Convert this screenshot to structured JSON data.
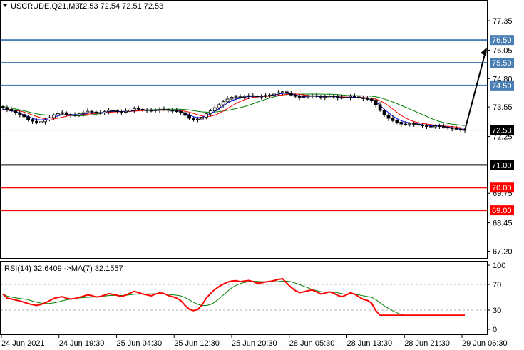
{
  "header": {
    "symbol": "USCRUDE.Q21,M30",
    "ohlc": "72.53 72.54 72.51 72.53"
  },
  "colors": {
    "blue_level": "#4a7fb5",
    "black_level": "#000000",
    "red_level": "#ff0000",
    "ma_fast": "#0000ff",
    "ma_mid": "#ff0000",
    "ma_slow": "#008000",
    "rsi_line": "#ff0000",
    "rsi_ma": "#008000",
    "candle": "#000000",
    "grid": "#c0c0c0",
    "current_price": "#c0c0c0"
  },
  "price_axis": {
    "labels": [
      "77.35",
      "76.05",
      "74.80",
      "73.55",
      "72.25",
      "69.75",
      "68.45",
      "67.20"
    ],
    "range": [
      66.9,
      78.2
    ]
  },
  "levels": [
    {
      "price": "76.50",
      "color": "blue"
    },
    {
      "price": "75.50",
      "color": "blue"
    },
    {
      "price": "74.50",
      "color": "blue"
    },
    {
      "price": "72.53",
      "color": "current"
    },
    {
      "price": "71.00",
      "color": "black"
    },
    {
      "price": "70.00",
      "color": "red"
    },
    {
      "price": "69.00",
      "color": "red"
    }
  ],
  "arrow": {
    "from_price": 72.53,
    "to_price": 76.3,
    "icon": "arrow-up-right-icon"
  },
  "rsi": {
    "title": "RSI(14) 32.6409  ->MA(7) 32.1557",
    "axis_labels": [
      "100",
      "70",
      "30",
      "0"
    ],
    "levels": [
      70,
      30
    ]
  },
  "time_axis": {
    "labels": [
      "24 Jun 2021",
      "24 Jun 19:30",
      "25 Jun 04:30",
      "25 Jun 12:30",
      "25 Jun 20:30",
      "28 Jun 05:30",
      "28 Jun 13:30",
      "28 Jun 21:30",
      "29 Jun 06:30"
    ]
  },
  "chart_data": {
    "type": "candlestick",
    "symbol": "USCRUDE.Q21",
    "timeframe": "M30",
    "close_series": [
      73.52,
      73.45,
      73.38,
      73.3,
      73.22,
      73.12,
      73.0,
      72.92,
      72.85,
      72.9,
      72.98,
      73.08,
      73.2,
      73.26,
      73.3,
      73.22,
      73.18,
      73.2,
      73.25,
      73.3,
      73.36,
      73.33,
      73.28,
      73.3,
      73.35,
      73.4,
      73.38,
      73.35,
      73.32,
      73.36,
      73.42,
      73.48,
      73.45,
      73.42,
      73.4,
      73.38,
      73.42,
      73.45,
      73.44,
      73.4,
      73.38,
      73.35,
      73.3,
      73.18,
      73.05,
      73.0,
      73.02,
      73.1,
      73.25,
      73.38,
      73.52,
      73.65,
      73.78,
      73.9,
      73.98,
      74.0,
      73.98,
      74.02,
      74.05,
      74.03,
      74.0,
      74.02,
      74.06,
      74.08,
      74.12,
      74.18,
      74.22,
      74.15,
      74.08,
      74.02,
      73.98,
      74.0,
      74.03,
      74.05,
      74.02,
      73.98,
      74.0,
      74.03,
      74.01,
      73.97,
      73.95,
      73.98,
      74.02,
      74.0,
      73.96,
      73.92,
      73.9,
      73.85,
      73.65,
      73.4,
      73.2,
      73.05,
      72.95,
      72.88,
      72.8,
      72.78,
      72.82,
      72.8,
      72.76,
      72.72,
      72.7,
      72.68,
      72.72,
      72.7,
      72.66,
      72.62,
      72.6,
      72.58,
      72.55,
      72.53
    ],
    "ma_fast": [
      73.45,
      73.42,
      73.38,
      73.34,
      73.28,
      73.2,
      73.12,
      73.05,
      73.0,
      72.98,
      73.0,
      73.04,
      73.1,
      73.16,
      73.2,
      73.22,
      73.22,
      73.21,
      73.22,
      73.24,
      73.28,
      73.3,
      73.3,
      73.3,
      73.32,
      73.35,
      73.36,
      73.36,
      73.35,
      73.35,
      73.37,
      73.4,
      73.42,
      73.42,
      73.41,
      73.4,
      73.4,
      73.41,
      73.42,
      73.41,
      73.4,
      73.38,
      73.35,
      73.28,
      73.2,
      73.12,
      73.08,
      73.1,
      73.16,
      73.25,
      73.36,
      73.48,
      73.6,
      73.72,
      73.82,
      73.9,
      73.94,
      73.98,
      74.01,
      74.02,
      74.02,
      74.02,
      74.03,
      74.05,
      74.08,
      74.12,
      74.15,
      74.15,
      74.12,
      74.08,
      74.04,
      74.02,
      74.02,
      74.03,
      74.02,
      74.0,
      74.0,
      74.01,
      74.01,
      73.99,
      73.97,
      73.97,
      73.98,
      73.98,
      73.96,
      73.94,
      73.92,
      73.88,
      73.78,
      73.62,
      73.45,
      73.3,
      73.15,
      73.04,
      72.95,
      72.88,
      72.85,
      72.83,
      72.8,
      72.77,
      72.74,
      72.72,
      72.72,
      72.71,
      72.69,
      72.66,
      72.64,
      72.61,
      72.58,
      72.56
    ]
  }
}
